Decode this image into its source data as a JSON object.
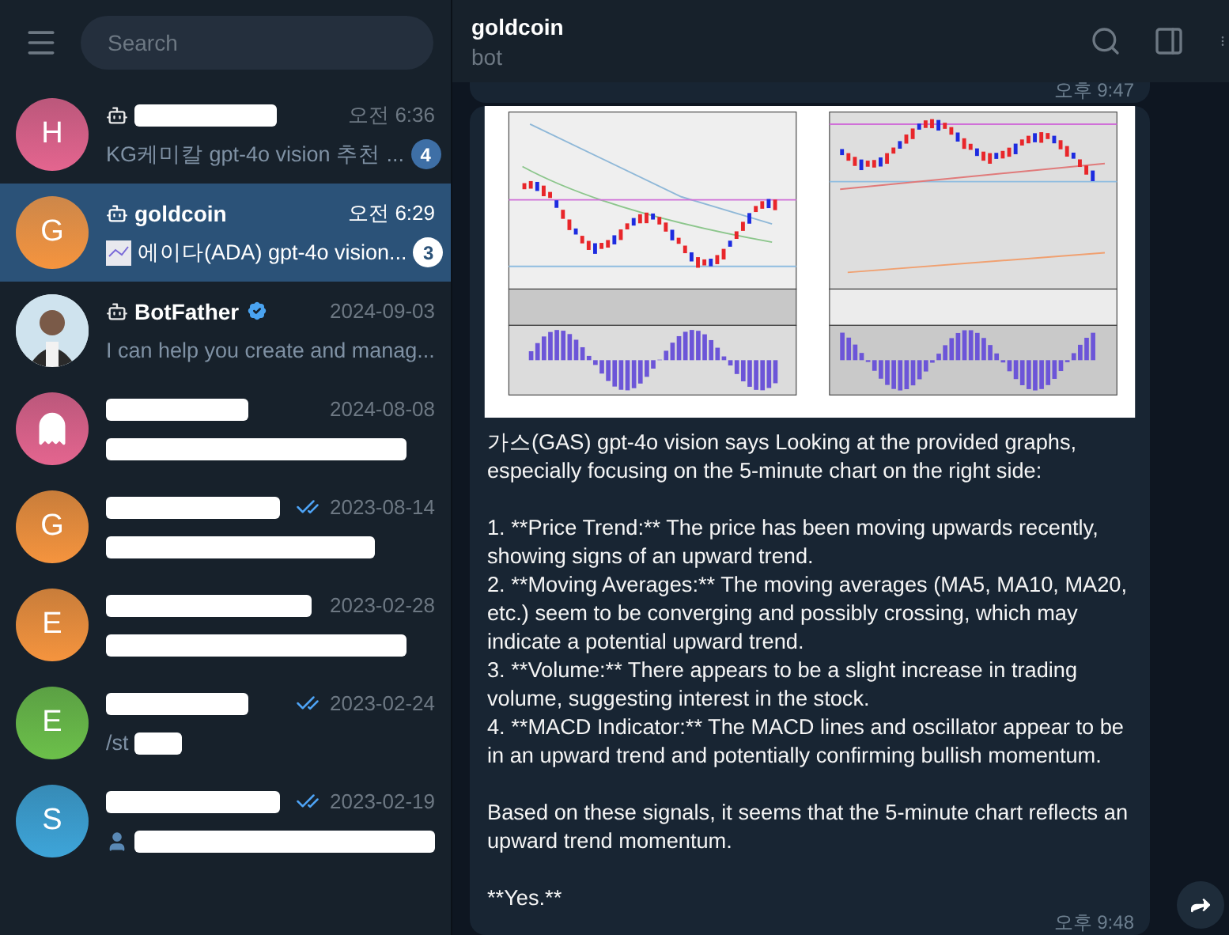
{
  "sidebar": {
    "search": {
      "placeholder": "Search"
    },
    "chats": [
      {
        "avatar": {
          "kind": "letter",
          "letter": "H",
          "color": "#e4658f"
        },
        "bot": true,
        "name_redacted": true,
        "time": "오전 6:36",
        "preview": "KG케미칼 gpt-4o vision 추천 ...",
        "unread": "4",
        "selected": false
      },
      {
        "avatar": {
          "kind": "letter",
          "letter": "G",
          "color": "#f5943e"
        },
        "bot": true,
        "name": "goldcoin",
        "time": "오전 6:29",
        "preview_thumb": true,
        "preview": "에이다(ADA) gpt-4o vision...",
        "unread": "3",
        "selected": true
      },
      {
        "bot": true,
        "name": "BotFather",
        "verified": true,
        "time": "2024-09-03",
        "preview": "I can help you create and manag...",
        "selected": false
      },
      {
        "avatar": {
          "kind": "ghost",
          "color": "#e4658f"
        },
        "name_redacted": true,
        "time": "2024-08-08",
        "preview_redacted": true,
        "selected": false
      },
      {
        "avatar": {
          "kind": "letter",
          "letter": "G",
          "color": "#f5943e"
        },
        "name_redacted": true,
        "read": true,
        "time": "2023-08-14",
        "preview_redacted": true,
        "selected": false
      },
      {
        "avatar": {
          "kind": "letter",
          "letter": "E",
          "color": "#f5943e"
        },
        "name_redacted": true,
        "time": "2023-02-28",
        "preview_redacted": true,
        "selected": false
      },
      {
        "avatar": {
          "kind": "letter",
          "letter": "E",
          "color": "#6cc04a"
        },
        "name_redacted": true,
        "read": true,
        "time": "2023-02-24",
        "preview": "/st",
        "preview_redacted": true,
        "selected": false
      },
      {
        "avatar": {
          "kind": "letter",
          "letter": "S",
          "color": "#3ea5d9"
        },
        "name_redacted": true,
        "read": true,
        "time": "2023-02-19",
        "preview_person": true,
        "preview_redacted": true,
        "selected": false
      }
    ]
  },
  "chat": {
    "title": "goldcoin",
    "subtitle": "bot",
    "previous_time": "오후 9:47",
    "message": {
      "text": "가스(GAS) gpt-4o vision says Looking at the provided graphs, especially focusing on the 5-minute chart on the right side:\n\n1. **Price Trend:** The price has been moving upwards recently, showing signs of an upward trend.\n2. **Moving Averages:** The moving averages (MA5, MA10, MA20, etc.) seem to be converging and possibly crossing, which may indicate a potential upward trend.\n3. **Volume:** There appears to be a slight increase in trading volume, suggesting interest in the stock.\n4. **MACD Indicator:** The MACD lines and oscillator appear to be in an upward trend and potentially confirming bullish momentum.\n\nBased on these signals, it seems that the 5-minute chart reflects an upward trend momentum.\n\n**Yes.**",
      "time": "오후 9:48"
    }
  }
}
